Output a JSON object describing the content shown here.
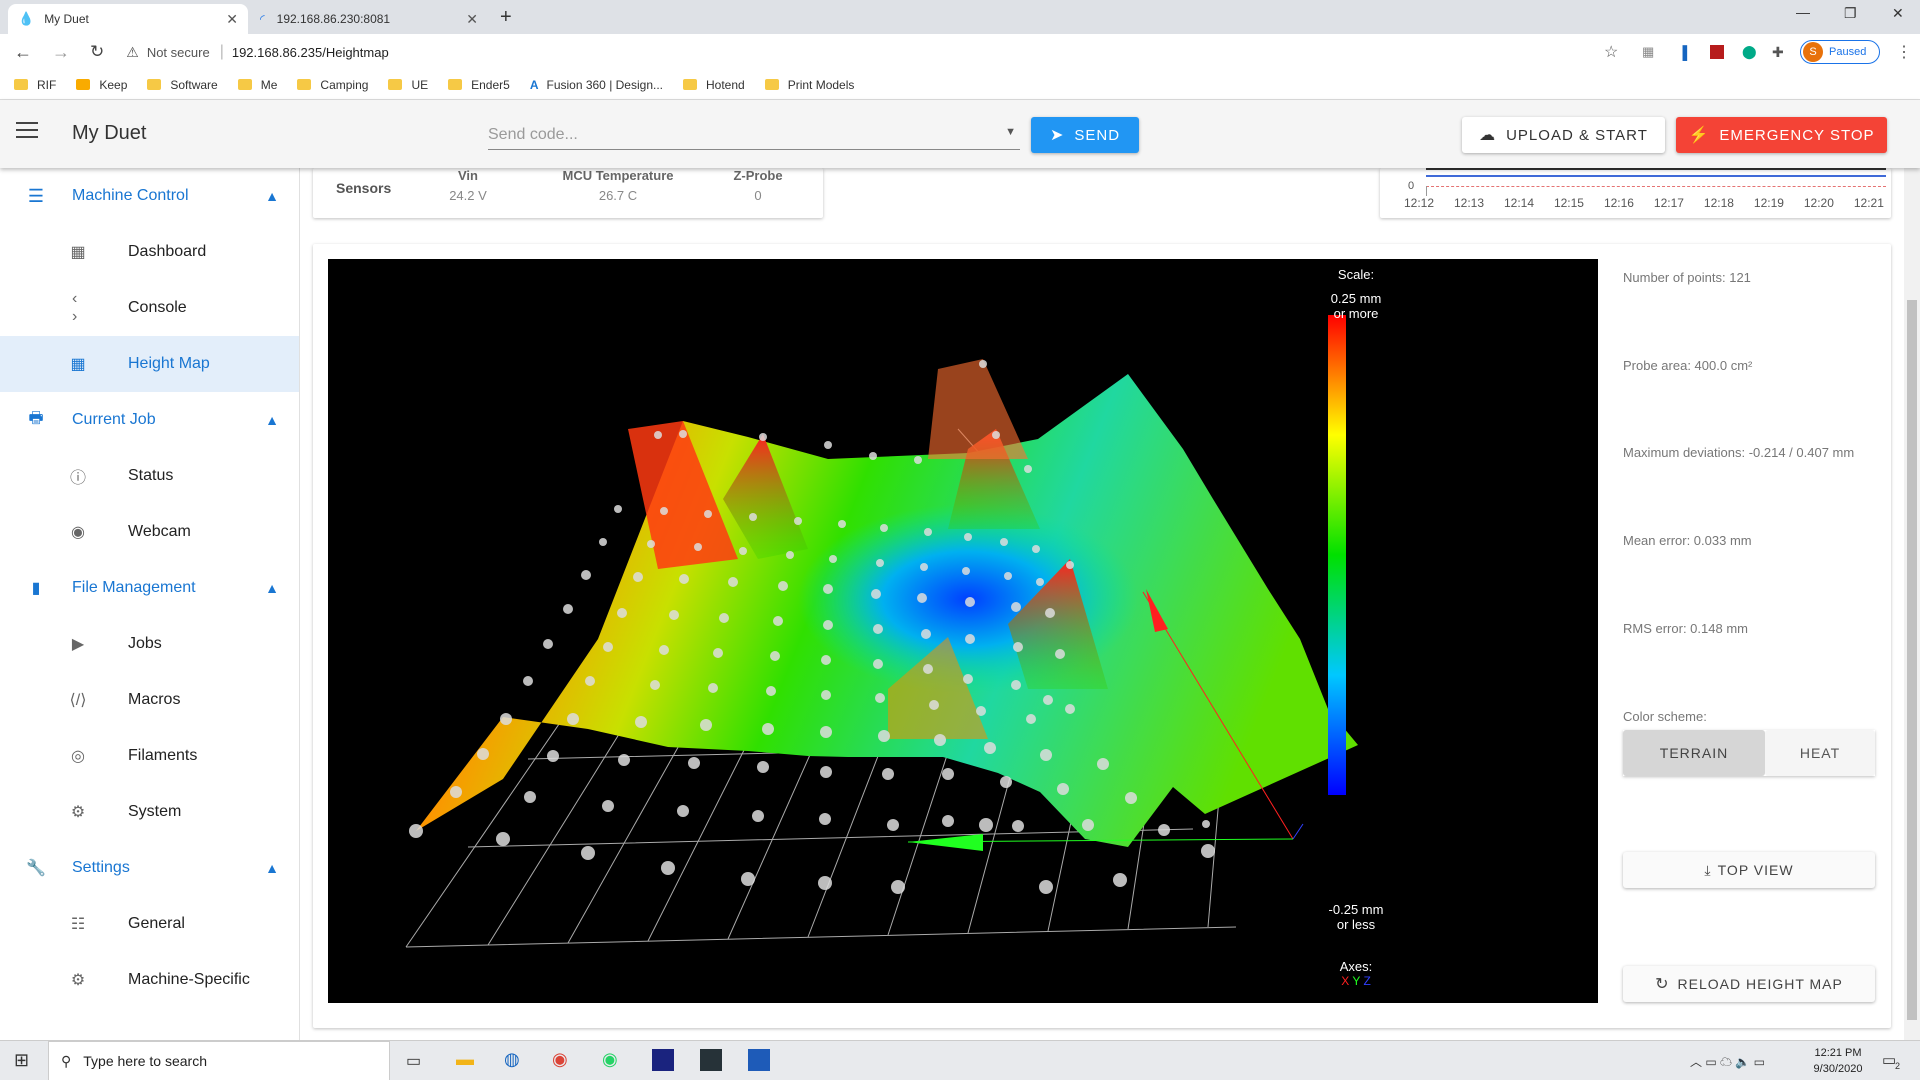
{
  "browser": {
    "tabs": [
      {
        "title": "My Duet"
      },
      {
        "title": "192.168.86.230:8081"
      }
    ],
    "security_label": "Not secure",
    "url": "192.168.86.235/Heightmap",
    "profile_status": "Paused",
    "profile_initial": "S",
    "bookmarks": [
      "RIF",
      "Keep",
      "Software",
      "Me",
      "Camping",
      "UE",
      "Ender5",
      "Fusion 360 | Design...",
      "Hotend",
      "Print Models"
    ]
  },
  "app": {
    "title": "My Duet",
    "code_placeholder": "Send code...",
    "send_label": "SEND",
    "upload_label": "UPLOAD & START",
    "estop_label": "EMERGENCY STOP"
  },
  "sidebar": {
    "groups": [
      {
        "label": "Machine Control",
        "icon": "sliders-icon",
        "items": [
          {
            "label": "Dashboard",
            "icon": "dashboard-icon"
          },
          {
            "label": "Console",
            "icon": "code-icon"
          },
          {
            "label": "Height Map",
            "icon": "grid-icon",
            "selected": true
          }
        ]
      },
      {
        "label": "Current Job",
        "icon": "printer-icon",
        "items": [
          {
            "label": "Status",
            "icon": "info-icon"
          },
          {
            "label": "Webcam",
            "icon": "webcam-icon"
          }
        ]
      },
      {
        "label": "File Management",
        "icon": "sd-card-icon",
        "items": [
          {
            "label": "Jobs",
            "icon": "play-icon"
          },
          {
            "label": "Macros",
            "icon": "macro-icon"
          },
          {
            "label": "Filaments",
            "icon": "filament-icon"
          },
          {
            "label": "System",
            "icon": "gear-icon"
          }
        ]
      },
      {
        "label": "Settings",
        "icon": "wrench-icon",
        "items": [
          {
            "label": "General",
            "icon": "tune-icon"
          },
          {
            "label": "Machine-Specific",
            "icon": "gears-icon"
          }
        ]
      }
    ]
  },
  "sensors": {
    "title": "Sensors",
    "columns": [
      {
        "label": "Vin",
        "value": "24.2 V"
      },
      {
        "label": "MCU Temperature",
        "value": "26.7 C"
      },
      {
        "label": "Z-Probe",
        "value": "0"
      }
    ]
  },
  "temp_chart": {
    "y_tick": "0",
    "x_ticks": [
      "12:12",
      "12:13",
      "12:14",
      "12:15",
      "12:16",
      "12:17",
      "12:18",
      "12:19",
      "12:20",
      "12:21"
    ]
  },
  "heightmap": {
    "scale_title": "Scale:",
    "scale_top": "0.25 mm",
    "scale_top2": "or more",
    "scale_bottom": "-0.25 mm",
    "scale_bottom2": "or less",
    "axes_label": "Axes:",
    "axis_x": "X",
    "axis_y": "Y",
    "axis_z": "Z",
    "axis_colors": {
      "x": "#ff2020",
      "y": "#20ff20",
      "z": "#3040ff"
    },
    "stats": {
      "points": "Number of points: 121",
      "area": "Probe area: 400.0 cm²",
      "deviation": "Maximum deviations: -0.214 / 0.407 mm",
      "mean": "Mean error: 0.033 mm",
      "rms": "RMS error: 0.148 mm"
    },
    "color_scheme_label": "Color scheme:",
    "scheme_terrain": "TERRAIN",
    "scheme_heat": "HEAT",
    "top_view_label": "TOP VIEW",
    "reload_label": "RELOAD HEIGHT MAP"
  },
  "taskbar": {
    "search_placeholder": "Type here to search",
    "time": "12:21 PM",
    "date": "9/30/2020",
    "notification_count": "2"
  }
}
